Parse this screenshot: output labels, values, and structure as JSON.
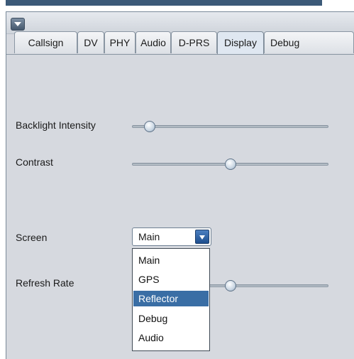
{
  "window": {
    "menu_icon": "chevron-down-icon"
  },
  "tabs": [
    {
      "label": "Callsign"
    },
    {
      "label": "DV"
    },
    {
      "label": "PHY"
    },
    {
      "label": "Audio"
    },
    {
      "label": "D-PRS"
    },
    {
      "label": "Display",
      "active": true
    },
    {
      "label": "Debug"
    }
  ],
  "display": {
    "backlight": {
      "label": "Backlight Intensity",
      "value": 0.05
    },
    "contrast": {
      "label": "Contrast",
      "value": 0.5
    },
    "screen": {
      "label": "Screen",
      "selected": "Main",
      "options": [
        "Main",
        "GPS",
        "Reflector",
        "Debug",
        "Audio"
      ],
      "highlighted": "Reflector"
    },
    "refresh_rate": {
      "label": "Refresh Rate",
      "value": 0.5
    }
  },
  "colors": {
    "accent": "#3a6ea5",
    "background": "#d6d9df"
  }
}
